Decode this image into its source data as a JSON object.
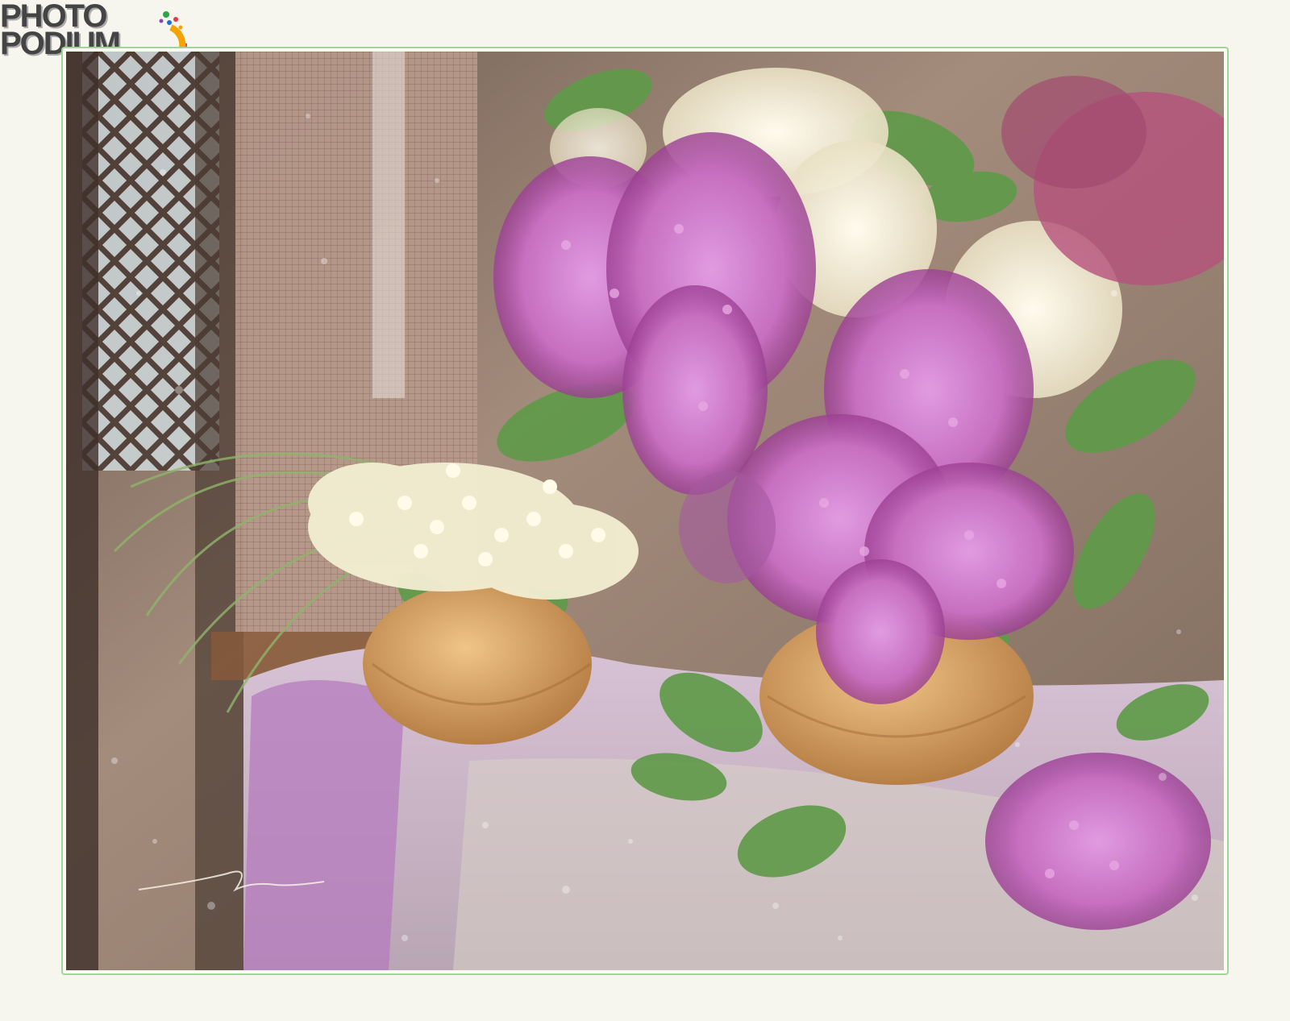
{
  "logo": {
    "line1": "PHOTO",
    "line2": "PODIUM"
  },
  "photo": {
    "subject": "lilac-still-life",
    "colors": {
      "background": "#f6f5ee",
      "frame_border": "#9fd49a",
      "lilac": "#c76fc0",
      "lilac_dark": "#9b3f93",
      "white_lilac": "#f4efdc",
      "leaf": "#5f9a4a",
      "vase": "#d8a366",
      "cloth": "#c9a6c8"
    }
  }
}
